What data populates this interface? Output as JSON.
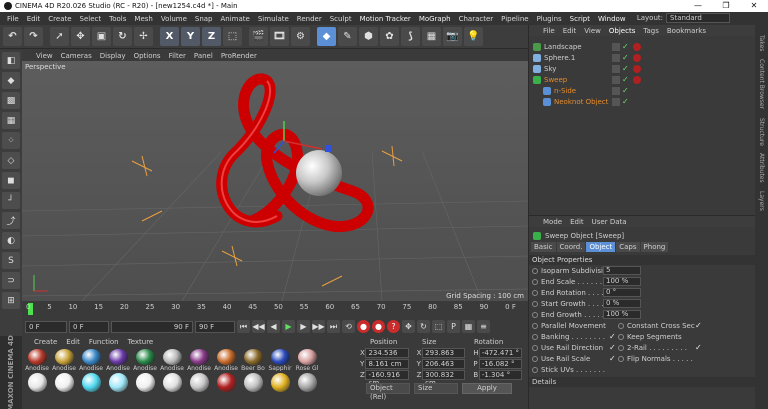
{
  "window": {
    "title": "CINEMA 4D R20.026 Studio (RC - R20) - [new1254.c4d *] - Main",
    "controls": [
      "—",
      "❐",
      "✕"
    ]
  },
  "menu": {
    "items": [
      "File",
      "Edit",
      "Create",
      "Select",
      "Tools",
      "Mesh",
      "Volume",
      "Snap",
      "Animate",
      "Simulate",
      "Render",
      "Sculpt",
      "Motion Tracker",
      "MoGraph",
      "Character",
      "Pipeline",
      "Plugins",
      "Script",
      "Window"
    ],
    "layout_label": "Layout:",
    "layout_value": "Standard"
  },
  "viewport": {
    "menu": [
      "View",
      "Cameras",
      "Display",
      "Options",
      "Filter",
      "Panel",
      "ProRender"
    ],
    "label": "Perspective",
    "grid_spacing": "Grid Spacing : 100 cm"
  },
  "timeline": {
    "ticks": [
      "0",
      "5",
      "10",
      "15",
      "20",
      "25",
      "30",
      "35",
      "40",
      "45",
      "50",
      "55",
      "60",
      "65",
      "70",
      "75",
      "80",
      "85",
      "90"
    ],
    "end_label": "0 F"
  },
  "playbar": {
    "start": "0 F",
    "current": "0 F",
    "end_mid": "90 F",
    "end": "90 F"
  },
  "materials": {
    "menu": [
      "Create",
      "Edit",
      "Function",
      "Texture"
    ],
    "row1": [
      "Anodise",
      "Anodise",
      "Anodise",
      "Anodise",
      "Anodise",
      "Anodise",
      "Anodise",
      "Anodise",
      "Beer Bo",
      "Sapphir",
      "Rose Gl"
    ],
    "row1_colors": [
      "#b93a2a",
      "#c8a23a",
      "#3a88c8",
      "#6a3aa8",
      "#2a8a4a",
      "#b9b9b9",
      "#8a3a8a",
      "#c86a2a",
      "#8a6a2a",
      "#2a4ab9",
      "#d8a0a0"
    ],
    "row2_colors": [
      "#e8e8e8",
      "#f0f0f0",
      "#4fd8f0",
      "#9fe8f8",
      "#f0f0f0",
      "#e0e0e0",
      "#c8c8c8",
      "#b02020",
      "#c0c0c0",
      "#e0b020",
      "#a8a8a8"
    ]
  },
  "coordinates": {
    "headers": [
      "Position",
      "Size",
      "Rotation"
    ],
    "rows": [
      {
        "axis": "X",
        "pos": "234.536 cm",
        "size": "293.863 cm",
        "rot_axis": "H",
        "rot": "-472.471 °"
      },
      {
        "axis": "Y",
        "pos": "8.161 cm",
        "size": "206.463 cm",
        "rot_axis": "P",
        "rot": "-16.082 °"
      },
      {
        "axis": "Z",
        "pos": "-160.916 cm",
        "size": "300.832 cm",
        "rot_axis": "B",
        "rot": "-1.304 °"
      }
    ],
    "mode": "Object (Rel)",
    "size_mode": "Size",
    "apply": "Apply"
  },
  "objects": {
    "menu": [
      "File",
      "Edit",
      "View",
      "Objects",
      "Tags",
      "Bookmarks"
    ],
    "items": [
      {
        "name": "Landscape",
        "indent": 0,
        "color": "#cfcfcf",
        "icon": "#4a9a4a"
      },
      {
        "name": "Sphere.1",
        "indent": 0,
        "color": "#cfcfcf",
        "icon": "#7fb0e0"
      },
      {
        "name": "Sky",
        "indent": 0,
        "color": "#cfcfcf",
        "icon": "#7fb0e0"
      },
      {
        "name": "Sweep",
        "indent": 0,
        "color": "#e58b2c",
        "icon": "#3ab04a"
      },
      {
        "name": "n-Side",
        "indent": 1,
        "color": "#e58b2c",
        "icon": "#5b8fd6"
      },
      {
        "name": "Neoknot Object",
        "indent": 1,
        "color": "#e58b2c",
        "icon": "#5b8fd6"
      }
    ]
  },
  "attributes": {
    "menu": [
      "Mode",
      "Edit",
      "User Data"
    ],
    "title": "Sweep Object [Sweep]",
    "tabs": [
      "Basic",
      "Coord.",
      "Object",
      "Caps",
      "Phong"
    ],
    "section": "Object Properties",
    "fields": [
      {
        "label": "Isoparm Subdivision",
        "value": "5"
      },
      {
        "label": "End Scale . . . . . . . .",
        "value": "100 %"
      },
      {
        "label": "End Rotation . . . . .",
        "value": "0 °"
      },
      {
        "label": "Start Growth . . . . .",
        "value": "0 %"
      },
      {
        "label": "End Growth . . . . . .",
        "value": "100 %"
      }
    ],
    "checks": [
      {
        "left": "Parallel Movement",
        "left_checked": false,
        "right": "Constant Cross Section",
        "right_checked": true
      },
      {
        "left": "Banking . . . . . . . .",
        "left_checked": true,
        "right": "Keep Segments",
        "right_checked": false
      },
      {
        "left": "Use Rail Direction",
        "left_checked": true,
        "right": "2-Rail . . . . . . . . .",
        "right_checked": true
      },
      {
        "left": "Use Rail Scale",
        "left_checked": true,
        "right": "Flip Normals . . . . .",
        "right_checked": false
      },
      {
        "left": "Stick UVs . . . . . . .",
        "left_checked": false,
        "right": "",
        "right_checked": false
      }
    ],
    "details": "Details"
  },
  "side_tabs": [
    "Takes",
    "Content Browser",
    "Structure",
    "Attributes",
    "Layers"
  ],
  "maxon": "MAXON CINEMA 4D"
}
